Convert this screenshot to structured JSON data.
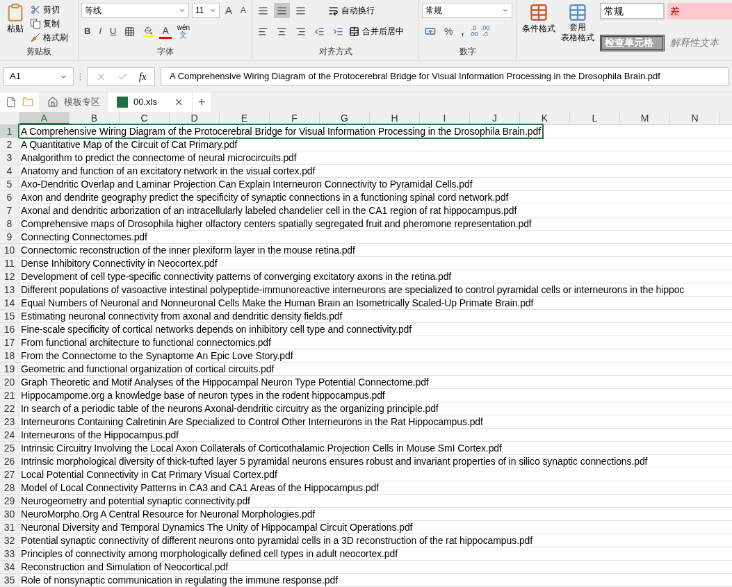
{
  "ribbon": {
    "clipboard": {
      "paste": "粘贴",
      "cut": "剪切",
      "copy": "复制",
      "format_painter": "格式刷",
      "label": "剪贴板"
    },
    "font": {
      "name": "等线",
      "size": "11",
      "grow": "A",
      "shrink": "A",
      "bold": "B",
      "italic": "I",
      "underline": "U",
      "font_color": "A",
      "phonetic_top": "wén",
      "phonetic_bottom": "文",
      "label": "字体"
    },
    "alignment": {
      "wrap": "自动换行",
      "merge": "合并后居中",
      "label": "对齐方式"
    },
    "number": {
      "format": "常规",
      "percent": "%",
      "comma": ",",
      "dec_increase": [
        ".0",
        ".00"
      ],
      "dec_decrease": [
        ".00",
        ".0"
      ],
      "label": "数字"
    },
    "styles": {
      "conditional": "条件格式",
      "table": [
        "套用",
        "表格格式"
      ],
      "cells": [
        {
          "label": "常规",
          "kind": "normal"
        },
        {
          "label": "差",
          "kind": "bad"
        },
        {
          "label": "检查单元格",
          "kind": "check"
        },
        {
          "label": "解释性文本",
          "kind": "explanatory"
        }
      ]
    }
  },
  "formula_bar": {
    "name_box": "A1",
    "fx": "fx",
    "value": "A Comprehensive Wiring Diagram of the Protocerebral Bridge for Visual Information Processing in the Drosophila Brain.pdf"
  },
  "tabs": [
    {
      "label": "模板专区",
      "kind": "home",
      "selected": false
    },
    {
      "label": "00.xls",
      "kind": "file",
      "selected": true
    }
  ],
  "new_tab": "+",
  "sheet": {
    "columns": [
      {
        "label": "A",
        "selected": true
      },
      {
        "label": "B",
        "selected": false
      },
      {
        "label": "C",
        "selected": false
      },
      {
        "label": "D",
        "selected": false
      },
      {
        "label": "E",
        "selected": false
      },
      {
        "label": "F",
        "selected": false
      },
      {
        "label": "G",
        "selected": false
      },
      {
        "label": "H",
        "selected": false
      },
      {
        "label": "I",
        "selected": false
      },
      {
        "label": "J",
        "selected": false
      },
      {
        "label": "K",
        "selected": false
      },
      {
        "label": "L",
        "selected": false
      },
      {
        "label": "M",
        "selected": false
      },
      {
        "label": "N",
        "selected": false
      }
    ],
    "rows": [
      {
        "number": "1",
        "value": "A Comprehensive Wiring Diagram of the Protocerebral Bridge for Visual Information Processing in the Drosophila Brain.pdf",
        "selected": true
      },
      {
        "number": "2",
        "value": "A Quantitative Map of the Circuit of Cat Primary.pdf",
        "selected": false
      },
      {
        "number": "3",
        "value": "Analgorithm to predict the connectome of neural microcircuits.pdf",
        "selected": false
      },
      {
        "number": "4",
        "value": "Anatomy and function of an excitatory network in the visual cortex.pdf",
        "selected": false
      },
      {
        "number": "5",
        "value": "Axo-Dendritic Overlap and Laminar Projection Can Explain Interneuron Connectivity to Pyramidal Cells.pdf",
        "selected": false
      },
      {
        "number": "6",
        "value": "Axon and dendrite geography predict the specificity of synaptic connections in a functioning spinal cord network.pdf",
        "selected": false
      },
      {
        "number": "7",
        "value": "Axonal and dendritic arborization of an intracellularly labeled chandelier cell in the CA1 region of rat hippocampus.pdf",
        "selected": false
      },
      {
        "number": "8",
        "value": "Comprehensive maps of Drosophila higher olfactory centers spatially segregated fruit and pheromone representation.pdf",
        "selected": false
      },
      {
        "number": "9",
        "value": "Connecting Connectomes.pdf",
        "selected": false
      },
      {
        "number": "10",
        "value": "Connectomic reconstruction of the inner plexiform layer in the mouse retina.pdf",
        "selected": false
      },
      {
        "number": "11",
        "value": "Dense Inhibitory Connectivity in Neocortex.pdf",
        "selected": false
      },
      {
        "number": "12",
        "value": "Development of cell type-specific connectivity patterns of converging excitatory axons in the retina.pdf",
        "selected": false
      },
      {
        "number": "13",
        "value": "Different populations of vasoactive intestinal polypeptide-immunoreactive interneurons are specialized to control pyramidal cells or interneurons in the hippoc",
        "selected": false
      },
      {
        "number": "14",
        "value": "Equal Numbers of Neuronal and Nonneuronal Cells Make the Human Brain an Isometrically Scaled-Up Primate Brain.pdf",
        "selected": false
      },
      {
        "number": "15",
        "value": "Estimating neuronal connectivity from axonal and dendritic density fields.pdf",
        "selected": false
      },
      {
        "number": "16",
        "value": "Fine-scale specificity of cortical networks depends on inhibitory cell type and connectivity.pdf",
        "selected": false
      },
      {
        "number": "17",
        "value": "From functional architecture to functional connectomics.pdf",
        "selected": false
      },
      {
        "number": "18",
        "value": "From the Connectome to the Synaptome An Epic Love Story.pdf",
        "selected": false
      },
      {
        "number": "19",
        "value": "Geometric and functional organization of cortical circuits.pdf",
        "selected": false
      },
      {
        "number": "20",
        "value": "Graph Theoretic and Motif Analyses of the Hippocampal Neuron Type Potential Connectome.pdf",
        "selected": false
      },
      {
        "number": "21",
        "value": "Hippocampome.org a knowledge base of neuron types in the rodent hippocampus.pdf",
        "selected": false
      },
      {
        "number": "22",
        "value": "In search of a periodic table of the neurons Axonal-dendritic circuitry as the organizing principle.pdf",
        "selected": false
      },
      {
        "number": "23",
        "value": "Interneurons Containing Calretinin Are Specialized to Control Other Interneurons in the Rat Hippocampus.pdf",
        "selected": false
      },
      {
        "number": "24",
        "value": "Interneurons of the Hippocampus.pdf",
        "selected": false
      },
      {
        "number": "25",
        "value": "Intrinsic Circuitry Involving the Local Axon Collaterals of Corticothalamic Projection Cells in Mouse SmI Cortex.pdf",
        "selected": false
      },
      {
        "number": "26",
        "value": "Intrinsic morphological diversity of thick-tufted layer 5 pyramidal neurons ensures robust and invariant properties of in silico synaptic connections.pdf",
        "selected": false
      },
      {
        "number": "27",
        "value": "Local Potential Connectivity in Cat Primary Visual Cortex.pdf",
        "selected": false
      },
      {
        "number": "28",
        "value": "Model of Local Connectivity Patterns in CA3 and CA1 Areas of the Hippocampus.pdf",
        "selected": false
      },
      {
        "number": "29",
        "value": "Neurogeometry and potential synaptic connectivity.pdf",
        "selected": false
      },
      {
        "number": "30",
        "value": "NeuroMorpho.Org A Central Resource for Neuronal Morphologies.pdf",
        "selected": false
      },
      {
        "number": "31",
        "value": "Neuronal Diversity and Temporal Dynamics The Unity of Hippocampal Circuit Operations.pdf",
        "selected": false
      },
      {
        "number": "32",
        "value": "Potential synaptic connectivity of different neurons onto pyramidal cells in a 3D reconstruction of the rat hippocampus.pdf",
        "selected": false
      },
      {
        "number": "33",
        "value": "Principles of connectivity among morphologically defined cell types in adult neocortex.pdf",
        "selected": false
      },
      {
        "number": "34",
        "value": "Reconstruction and Simulation of Neocortical.pdf",
        "selected": false
      },
      {
        "number": "35",
        "value": "Role of nonsynaptic communication in regulating the immune response.pdf",
        "selected": false
      }
    ]
  }
}
